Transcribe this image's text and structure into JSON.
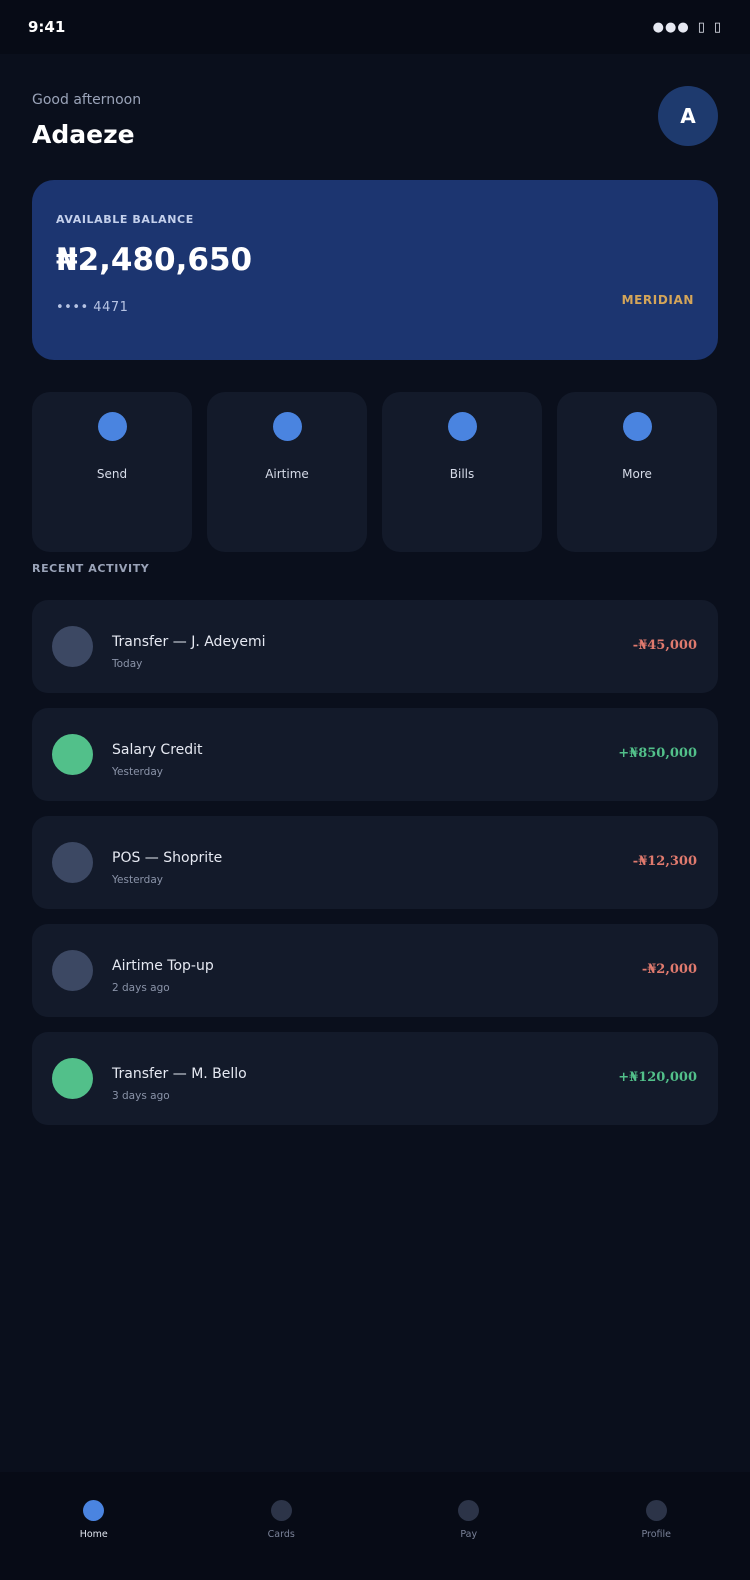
{
  "status_bar": {
    "time": "9:41",
    "icons": [
      "signal-icon",
      "wifi-icon",
      "battery-icon"
    ],
    "icon_glyphs": [
      "●●●",
      "▯",
      "▯"
    ]
  },
  "header": {
    "greeting": "Good afternoon",
    "name": "Adaeze",
    "avatar_initial": "A"
  },
  "balance_card": {
    "label": "AVAILABLE BALANCE",
    "amount": "₦2,480,650",
    "account_mask": "•••• 4471",
    "bank": "MERIDIAN"
  },
  "quick_actions": [
    {
      "label": "Send",
      "icon": "send-icon"
    },
    {
      "label": "Airtime",
      "icon": "airtime-icon"
    },
    {
      "label": "Bills",
      "icon": "bills-icon"
    },
    {
      "label": "More",
      "icon": "more-icon"
    }
  ],
  "recent_activity": {
    "title": "RECENT ACTIVITY",
    "items": [
      {
        "title": "Transfer — J. Adeyemi",
        "date": "Today",
        "amount": "-₦45,000",
        "type": "debit"
      },
      {
        "title": "Salary Credit",
        "date": "Yesterday",
        "amount": "+₦850,000",
        "type": "credit"
      },
      {
        "title": "POS — Shoprite",
        "date": "Yesterday",
        "amount": "-₦12,300",
        "type": "debit"
      },
      {
        "title": "Airtime Top-up",
        "date": "2 days ago",
        "amount": "-₦2,000",
        "type": "debit"
      },
      {
        "title": "Transfer — M. Bello",
        "date": "3 days ago",
        "amount": "+₦120,000",
        "type": "credit"
      }
    ]
  },
  "bottom_nav": [
    {
      "label": "Home",
      "active": true
    },
    {
      "label": "Cards",
      "active": false
    },
    {
      "label": "Pay",
      "active": false
    },
    {
      "label": "Profile",
      "active": false
    }
  ],
  "colors": {
    "background": "#0a0f1c",
    "card": "#1c3570",
    "accent": "#4a84e0",
    "credit": "#52c08a",
    "debit": "#e07a6e",
    "bank_gold": "#d4a559",
    "debit_icon": "#3c4863"
  }
}
